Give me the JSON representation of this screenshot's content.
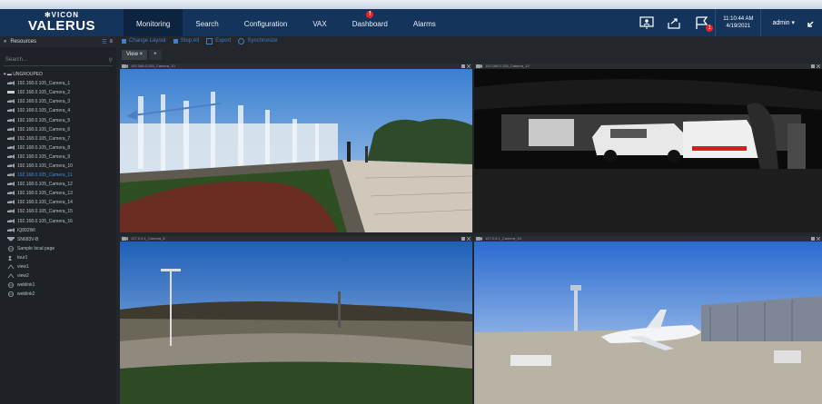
{
  "app": {
    "brand_top": "VICON",
    "brand_name": "VALERUS"
  },
  "nav": {
    "tabs": [
      "Monitoring",
      "Search",
      "Configuration",
      "VAX",
      "Dashboard",
      "Alarms"
    ],
    "active": "Monitoring",
    "dashboard_alert": "!"
  },
  "header": {
    "time": "11:10:44 AM",
    "date": "4/19/2021",
    "user": "admin ▾",
    "notification_count": "1"
  },
  "sidebar": {
    "title": "Resources",
    "search_placeholder": "Search...",
    "group": "UNGROUPED",
    "items": [
      {
        "label": "192.168.0.105_Camera_1",
        "icon": "camera-icon"
      },
      {
        "label": "192.168.0.105_Camera_2",
        "icon": "box-camera-icon"
      },
      {
        "label": "192.168.0.105_Camera_3",
        "icon": "camera-icon"
      },
      {
        "label": "192.168.0.105_Camera_4",
        "icon": "camera-icon"
      },
      {
        "label": "192.168.0.105_Camera_5",
        "icon": "camera-icon"
      },
      {
        "label": "192.168.0.105_Camera_6",
        "icon": "camera-icon"
      },
      {
        "label": "192.168.0.105_Camera_7",
        "icon": "camera-icon"
      },
      {
        "label": "192.168.0.105_Camera_8",
        "icon": "camera-icon"
      },
      {
        "label": "192.168.0.105_Camera_9",
        "icon": "camera-icon"
      },
      {
        "label": "192.168.0.105_Camera_10",
        "icon": "camera-icon"
      },
      {
        "label": "192.168.0.105_Camera_11",
        "icon": "camera-icon",
        "selected": true
      },
      {
        "label": "192.168.0.105_Camera_12",
        "icon": "camera-icon"
      },
      {
        "label": "192.168.0.105_Camera_13",
        "icon": "camera-icon"
      },
      {
        "label": "192.168.0.105_Camera_14",
        "icon": "camera-icon"
      },
      {
        "label": "192.168.0.105_Camera_15",
        "icon": "camera-icon"
      },
      {
        "label": "192.168.0.105_Camera_16",
        "icon": "camera-icon"
      },
      {
        "label": "IQ892WI",
        "icon": "camera-icon"
      },
      {
        "label": "SN683V-B",
        "icon": "dome-camera-icon"
      },
      {
        "label": "Sample local page",
        "icon": "globe-icon"
      },
      {
        "label": "tour1",
        "icon": "tour-icon"
      },
      {
        "label": "view1",
        "icon": "view-icon"
      },
      {
        "label": "view2",
        "icon": "view-icon"
      },
      {
        "label": "weblink1",
        "icon": "globe-icon"
      },
      {
        "label": "weblink2",
        "icon": "globe-icon"
      }
    ]
  },
  "toolbar": {
    "items": [
      "Change Layout",
      "Stop All",
      "Export",
      "Synchronize"
    ]
  },
  "view_tabs": {
    "tabs": [
      "View ×",
      "+"
    ]
  },
  "cameras": [
    {
      "label": "192.168.0.105_Camera_10",
      "overlay": "127.0.0.1_Camera_2"
    },
    {
      "label": "192.168.0.105_Camera_12",
      "overlay": "127.0.0.1_Camera_3"
    },
    {
      "label": "127.0.0.1_Camera_8"
    },
    {
      "label": "127.0.0.1_Camera_10"
    }
  ],
  "colors": {
    "brand": "#14345c",
    "accent": "#3d7fcf",
    "selected": "#3e8ee8",
    "alert": "#e22222"
  }
}
